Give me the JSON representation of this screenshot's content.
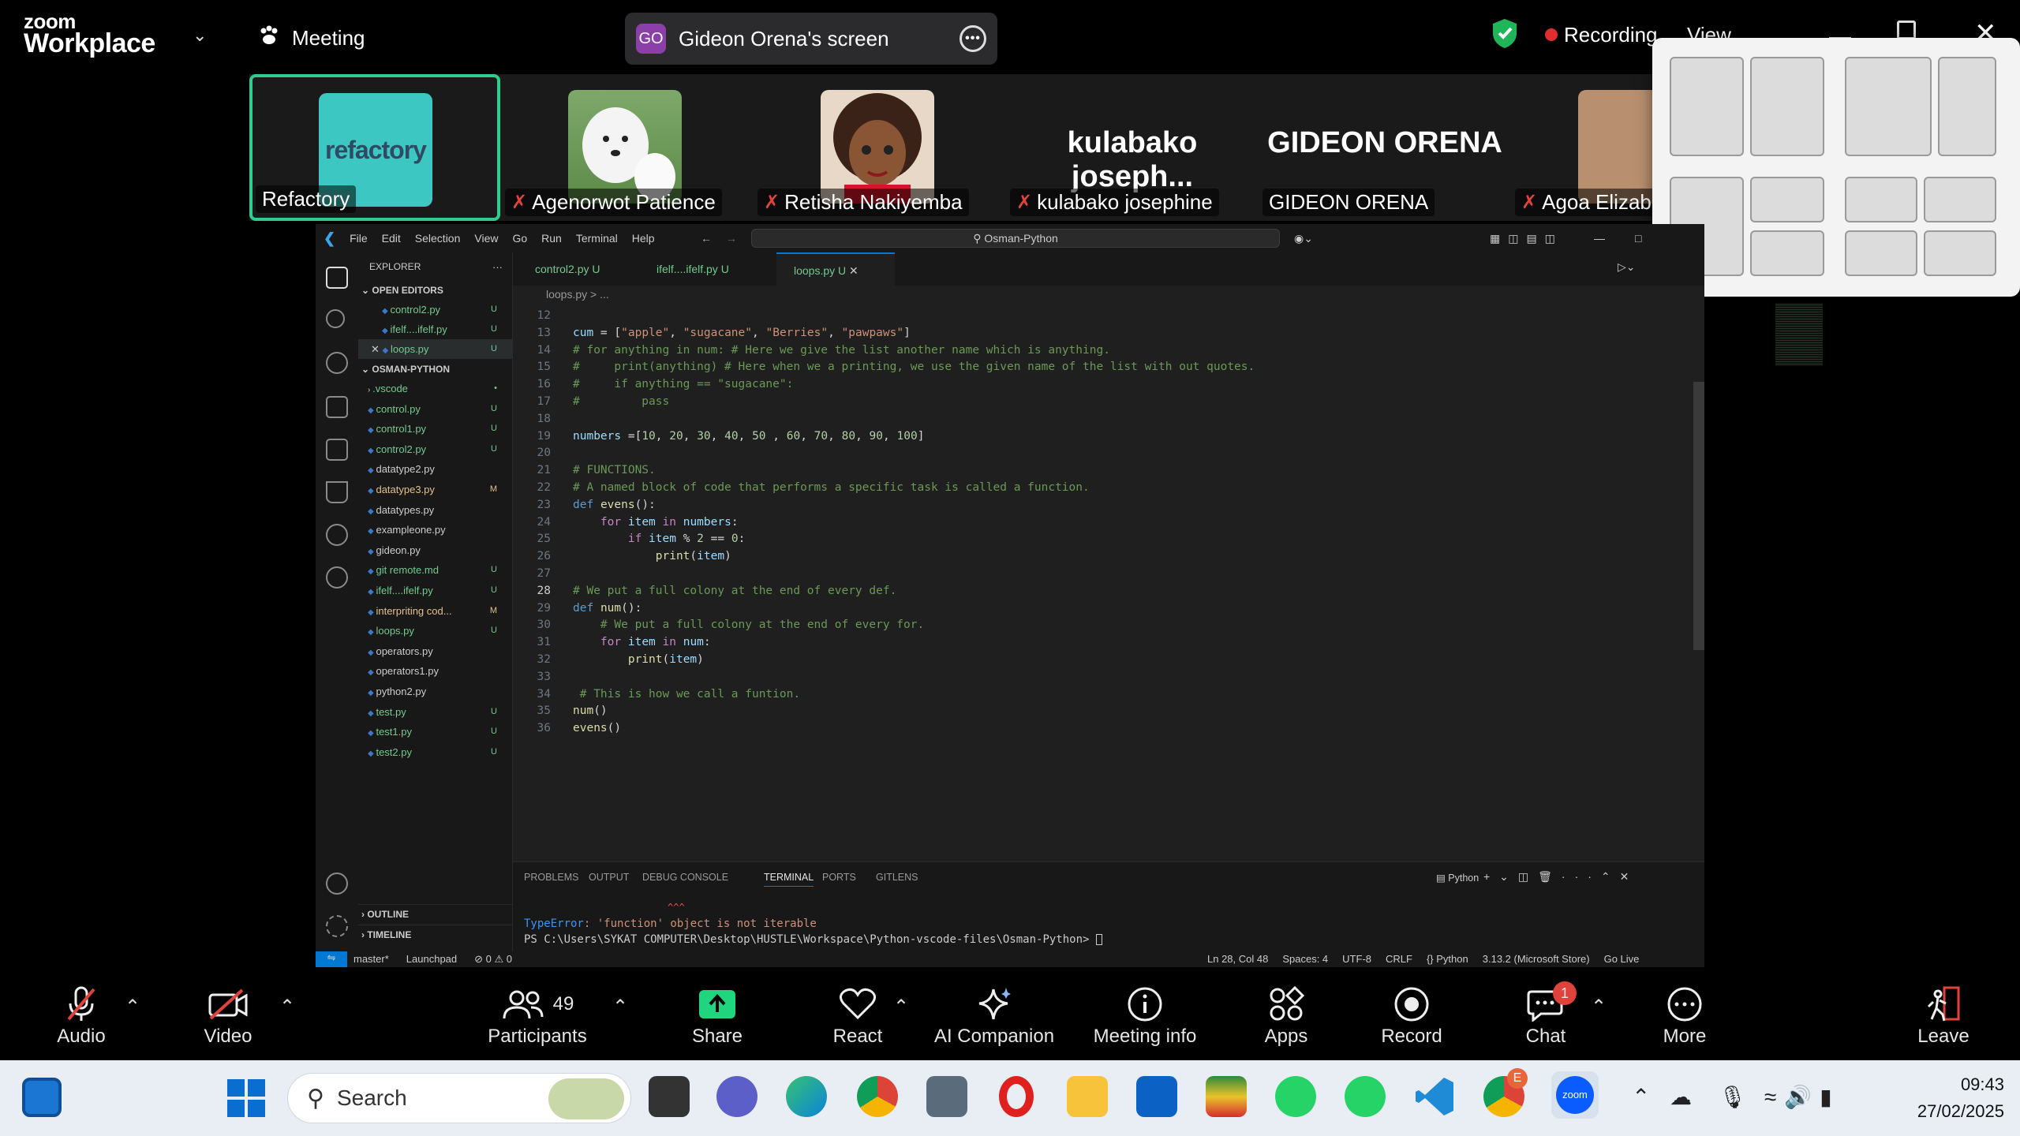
{
  "zoom": {
    "brand_top": "zoom",
    "brand_bottom": "Workplace",
    "meeting_label": "Meeting",
    "share_banner": {
      "avatar": "GO",
      "text": "Gideon Orena's screen"
    },
    "recording_label": "Recording",
    "view_label": "View"
  },
  "participants": [
    {
      "name": "Refactory",
      "logo": "refactory",
      "muted": false,
      "active": true
    },
    {
      "name": "Agenorwot Patience",
      "muted": true
    },
    {
      "name": "Retisha Nakiyemba",
      "muted": true
    },
    {
      "name": "kulabako josephine",
      "big": "kulabako joseph...",
      "muted": true
    },
    {
      "name": "GIDEON ORENA",
      "big": "GIDEON ORENA",
      "muted": false
    },
    {
      "name": "Agoa Elizab",
      "muted": true
    }
  ],
  "vscode": {
    "menu": [
      "File",
      "Edit",
      "Selection",
      "View",
      "Go",
      "Run",
      "Terminal",
      "Help"
    ],
    "search": "Osman-Python",
    "explorer_title": "EXPLORER",
    "open_editors_title": "OPEN EDITORS",
    "open_editors": [
      {
        "name": "control2.py",
        "badge": "U"
      },
      {
        "name": "ifelf....ifelf.py",
        "badge": "U"
      },
      {
        "name": "loops.py",
        "badge": "U"
      }
    ],
    "folder_title": "OSMAN-PYTHON",
    "files": [
      {
        "name": ".vscode",
        "badge": "•",
        "c": "g"
      },
      {
        "name": "control.py",
        "badge": "U",
        "c": "g"
      },
      {
        "name": "control1.py",
        "badge": "U",
        "c": "g"
      },
      {
        "name": "control2.py",
        "badge": "U",
        "c": "g"
      },
      {
        "name": "datatype2.py",
        "badge": "",
        "c": "wht"
      },
      {
        "name": "datatype3.py",
        "badge": "M",
        "c": "yel"
      },
      {
        "name": "datatypes.py",
        "badge": "",
        "c": "wht"
      },
      {
        "name": "exampleone.py",
        "badge": "",
        "c": "wht"
      },
      {
        "name": "gideon.py",
        "badge": "",
        "c": "wht"
      },
      {
        "name": "git remote.md",
        "badge": "U",
        "c": "g"
      },
      {
        "name": "ifelf....ifelf.py",
        "badge": "U",
        "c": "g"
      },
      {
        "name": "interpriting cod...",
        "badge": "M",
        "c": "yel"
      },
      {
        "name": "loops.py",
        "badge": "U",
        "c": "g"
      },
      {
        "name": "operators.py",
        "badge": "",
        "c": "wht"
      },
      {
        "name": "operators1.py",
        "badge": "",
        "c": "wht"
      },
      {
        "name": "python2.py",
        "badge": "",
        "c": "wht"
      },
      {
        "name": "test.py",
        "badge": "U",
        "c": "g"
      },
      {
        "name": "test1.py",
        "badge": "U",
        "c": "g"
      },
      {
        "name": "test2.py",
        "badge": "U",
        "c": "g"
      }
    ],
    "outline_title": "OUTLINE",
    "timeline_title": "TIMELINE",
    "tabs": [
      {
        "name": "control2.py",
        "badge": "U"
      },
      {
        "name": "ifelf....ifelf.py",
        "badge": "U"
      },
      {
        "name": "loops.py",
        "badge": "U",
        "active": true
      }
    ],
    "breadcrumb": "loops.py > ...",
    "code": [
      {
        "n": "12",
        "h": ""
      },
      {
        "n": "13",
        "h": "<span class='vr'>cum</span> = [<span class='st'>\"apple\"</span>, <span class='st'>\"sugacane\"</span>, <span class='st'>\"Berries\"</span>, <span class='st'>\"pawpaws\"</span>]"
      },
      {
        "n": "14",
        "h": "<span class='cm'># for anything in num: # Here we give the list another name which is anything.</span>"
      },
      {
        "n": "15",
        "h": "<span class='cm'>#     print(anything) # Here when we a printing, we use the given name of the list with out quotes.</span>"
      },
      {
        "n": "16",
        "h": "<span class='cm'>#     if anything == \"sugacane\":</span>"
      },
      {
        "n": "17",
        "h": "<span class='cm'>#         pass</span>"
      },
      {
        "n": "18",
        "h": ""
      },
      {
        "n": "19",
        "h": "<span class='vr'>numbers</span> =[<span class='nm'>10</span>, <span class='nm'>20</span>, <span class='nm'>30</span>, <span class='nm'>40</span>, <span class='nm'>50</span> , <span class='nm'>60</span>, <span class='nm'>70</span>, <span class='nm'>80</span>, <span class='nm'>90</span>, <span class='nm'>100</span>]"
      },
      {
        "n": "20",
        "h": ""
      },
      {
        "n": "21",
        "h": "<span class='cm'># FUNCTIONS.</span>"
      },
      {
        "n": "22",
        "h": "<span class='cm'># A named block of code that performs a specific task is called a function.</span>"
      },
      {
        "n": "23",
        "h": "<span class='kw'>def</span> <span class='fn'>evens</span>():"
      },
      {
        "n": "24",
        "h": "    <span class='kw2'>for</span> <span class='vr'>item</span> <span class='kw2'>in</span> <span class='vr'>numbers</span>:"
      },
      {
        "n": "25",
        "h": "        <span class='kw2'>if</span> <span class='vr'>item</span> % <span class='nm'>2</span> == <span class='nm'>0</span>:"
      },
      {
        "n": "26",
        "h": "            <span class='fn'>print</span>(<span class='vr'>item</span>)"
      },
      {
        "n": "27",
        "h": ""
      },
      {
        "n": "28",
        "h": "<span class='cm'># We put a full colony at the end of every def.</span>"
      },
      {
        "n": "29",
        "h": "<span class='kw'>def</span> <span class='fn'>num</span>():"
      },
      {
        "n": "30",
        "h": "    <span class='cm'># We put a full colony at the end of every for.</span>"
      },
      {
        "n": "31",
        "h": "    <span class='kw2'>for</span> <span class='vr'>item</span> <span class='kw2'>in</span> <span class='vr'>num</span>:"
      },
      {
        "n": "32",
        "h": "        <span class='fn'>print</span>(<span class='vr'>item</span>)"
      },
      {
        "n": "33",
        "h": ""
      },
      {
        "n": "34",
        "h": " <span class='cm'># This is how we call a funtion.</span>"
      },
      {
        "n": "35",
        "h": "<span class='fn'>num</span>()"
      },
      {
        "n": "36",
        "h": "<span class='fn'>evens</span>()"
      }
    ],
    "panel_tabs": [
      "PROBLEMS",
      "OUTPUT",
      "DEBUG CONSOLE",
      "TERMINAL",
      "PORTS",
      "GITLENS"
    ],
    "panel_active": "TERMINAL",
    "panel_python": "Python",
    "term_err_prefix": "TypeError",
    "term_err_msg": ": 'function' object is not iterable",
    "term_prompt": "PS C:\\Users\\SYKAT COMPUTER\\Desktop\\HUSTLE\\Workspace\\Python-vscode-files\\Osman-Python>",
    "status_left": [
      "master*",
      "Launchpad",
      "⊘ 0 ⚠ 0"
    ],
    "status_right": [
      "Ln 28, Col 48",
      "Spaces: 4",
      "UTF-8",
      "CRLF",
      "{} Python",
      "3.13.2 (Microsoft Store)",
      "Go Live"
    ]
  },
  "toolbar": [
    {
      "key": "audio",
      "label": "Audio"
    },
    {
      "key": "video",
      "label": "Video"
    },
    {
      "key": "participants",
      "label": "Participants",
      "count": "49"
    },
    {
      "key": "share",
      "label": "Share"
    },
    {
      "key": "react",
      "label": "React"
    },
    {
      "key": "ai",
      "label": "AI Companion"
    },
    {
      "key": "info",
      "label": "Meeting info"
    },
    {
      "key": "apps",
      "label": "Apps"
    },
    {
      "key": "record",
      "label": "Record"
    },
    {
      "key": "chat",
      "label": "Chat",
      "badge": "1"
    },
    {
      "key": "more",
      "label": "More"
    },
    {
      "key": "leave",
      "label": "Leave"
    }
  ],
  "taskbar": {
    "search": "Search",
    "time": "09:43",
    "date": "27/02/2025",
    "chrome_badge": "E"
  },
  "colors": {
    "accent_green": "#2ecc8f",
    "vscode_blue": "#0078d4",
    "share_green": "#1fd67f",
    "record_red": "#e02d2d",
    "zoom_blue": "#0b5cff"
  }
}
